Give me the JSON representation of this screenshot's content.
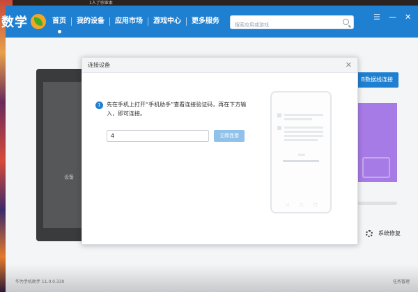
{
  "app": {
    "logo_text": "数学",
    "nav": [
      {
        "label": "首页",
        "active": true
      },
      {
        "label": "我的设备",
        "active": false
      },
      {
        "label": "应用市场",
        "active": false
      },
      {
        "label": "游戏中心",
        "active": false
      },
      {
        "label": "更多服务",
        "active": false
      }
    ],
    "search": {
      "placeholder": "搜索应用或游戏"
    },
    "window_controls": {
      "menu": "☰",
      "minimize": "—",
      "close": "✕"
    },
    "desktop_top_text": "1人了宗亚本"
  },
  "background": {
    "phone_label": "设备",
    "usb_button_label": "B数据线连接",
    "repair_label": "系统修复",
    "status_left": "华为手机助手 11.0.0.330",
    "status_right": "任务管理"
  },
  "dialog": {
    "title": "连接设备",
    "close_glyph": "✕",
    "step_number": "1",
    "instruction": "先在手机上打开“手机助手”查看连接验证码，再在下方输入，即可连接。",
    "code_value": "4",
    "connect_button": "立即连接"
  },
  "colors": {
    "brand_blue": "#1f7fd1",
    "button_disabled": "#8fc1ea",
    "accent_purple": "#a77be6"
  }
}
